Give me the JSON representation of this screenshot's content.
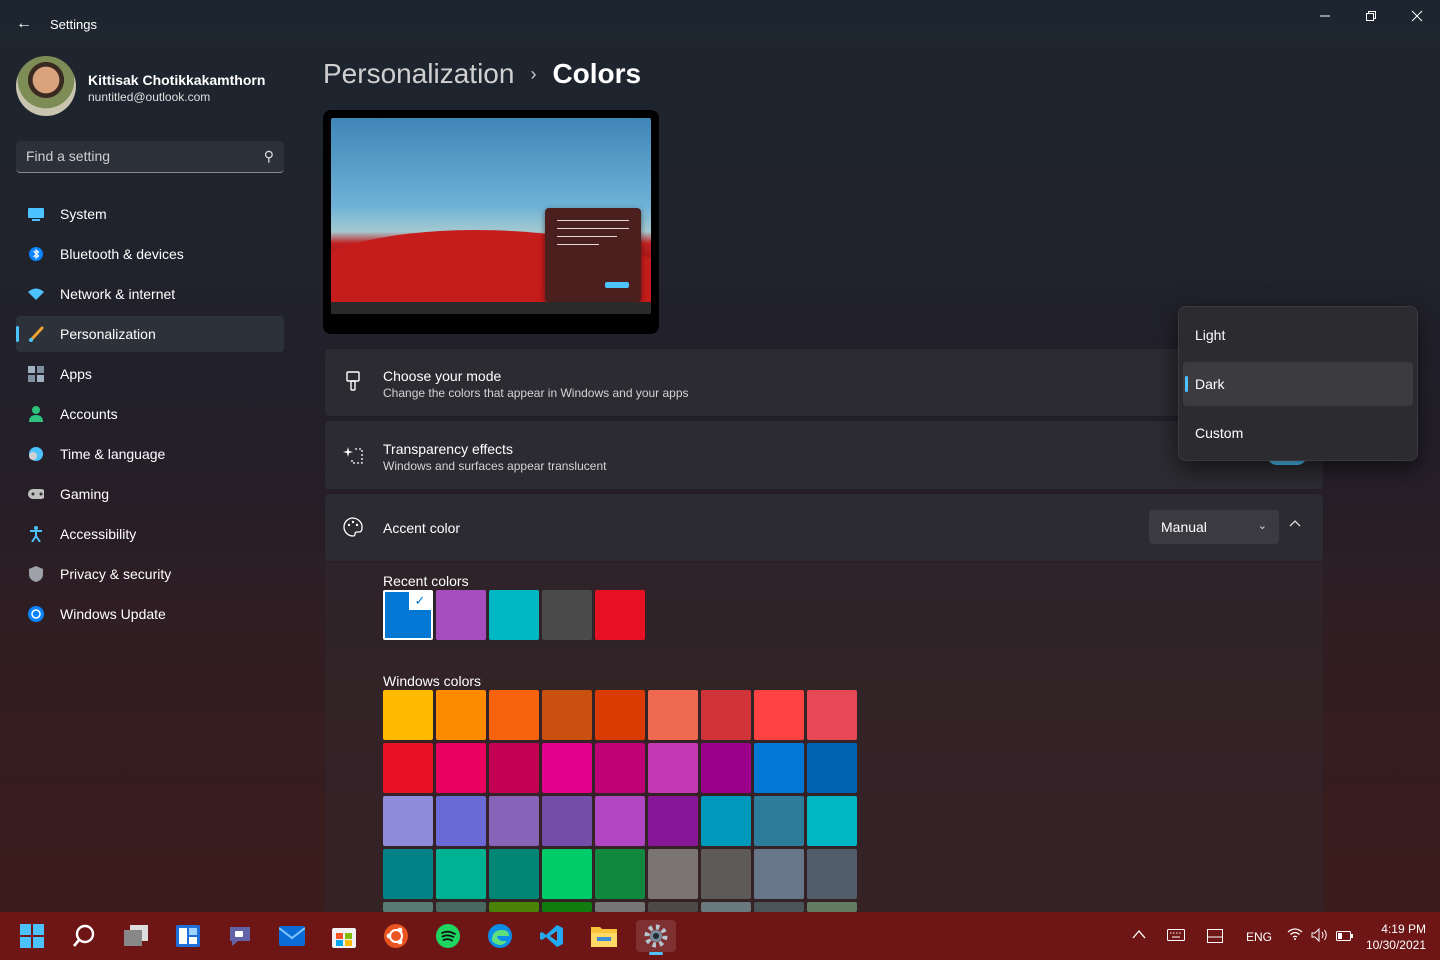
{
  "window": {
    "title": "Settings"
  },
  "profile": {
    "name": "Kittisak Chotikkakamthorn",
    "email": "nuntitled@outlook.com"
  },
  "search": {
    "placeholder": "Find a setting"
  },
  "nav": [
    {
      "label": "System",
      "icon": "monitor-icon",
      "color": "#4cc2ff"
    },
    {
      "label": "Bluetooth & devices",
      "icon": "bluetooth-icon",
      "color": "#0a84ff"
    },
    {
      "label": "Network & internet",
      "icon": "wifi-icon",
      "color": "#4cc2ff"
    },
    {
      "label": "Personalization",
      "icon": "brush-icon",
      "color": "#f0a030",
      "active": true
    },
    {
      "label": "Apps",
      "icon": "apps-icon",
      "color": "#a0b0c0"
    },
    {
      "label": "Accounts",
      "icon": "person-icon",
      "color": "#2ec27e"
    },
    {
      "label": "Time & language",
      "icon": "globe-clock-icon",
      "color": "#4cc2ff"
    },
    {
      "label": "Gaming",
      "icon": "gamepad-icon",
      "color": "#c0c0c0"
    },
    {
      "label": "Accessibility",
      "icon": "accessibility-icon",
      "color": "#4cc2ff"
    },
    {
      "label": "Privacy & security",
      "icon": "shield-icon",
      "color": "#a0a0a8"
    },
    {
      "label": "Windows Update",
      "icon": "update-icon",
      "color": "#4cc2ff"
    }
  ],
  "breadcrumb": {
    "parent": "Personalization",
    "current": "Colors"
  },
  "mode": {
    "title": "Choose your mode",
    "subtitle": "Change the colors that appear in Windows and your apps"
  },
  "transparency": {
    "title": "Transparency effects",
    "subtitle": "Windows and surfaces appear translucent",
    "state_label": "On",
    "on": true
  },
  "accent": {
    "title": "Accent color",
    "selected": "Manual"
  },
  "mode_options": [
    {
      "label": "Light",
      "selected": false
    },
    {
      "label": "Dark",
      "selected": true
    },
    {
      "label": "Custom",
      "selected": false
    }
  ],
  "recent_colors_label": "Recent colors",
  "recent_colors": [
    "#0078d4",
    "#a54dbf",
    "#00b7c3",
    "#4a4a4a",
    "#e81123"
  ],
  "windows_colors_label": "Windows colors",
  "windows_colors": [
    "#ffb900",
    "#ff8c00",
    "#f7630c",
    "#ca5010",
    "#da3b01",
    "#ef6950",
    "#d13438",
    "#ff4343",
    "#e74856",
    "#e81123",
    "#ea005e",
    "#c30052",
    "#e3008c",
    "#bf0077",
    "#c239b3",
    "#9a0089",
    "#0078d4",
    "#0063b1",
    "#8e8cd8",
    "#6b69d6",
    "#8764b8",
    "#744da9",
    "#b146c2",
    "#881798",
    "#0099bc",
    "#2d7d9a",
    "#00b7c3",
    "#038387",
    "#00b294",
    "#018574",
    "#00cc6a",
    "#10893e",
    "#7a7574",
    "#5d5a58",
    "#68768a",
    "#515c6b",
    "#567c73",
    "#486860",
    "#498205",
    "#107c10",
    "#767676",
    "#4c4a48",
    "#69797e",
    "#4a5459",
    "#647c64"
  ],
  "taskbar": {
    "apps": [
      "windows-start-icon",
      "search-icon",
      "task-view-icon",
      "widgets-icon",
      "teams-chat-icon",
      "mail-icon",
      "store-icon",
      "ubuntu-icon",
      "spotify-icon",
      "edge-icon",
      "vscode-icon",
      "file-explorer-icon",
      "settings-icon"
    ],
    "lang": "ENG",
    "time": "4:19 PM",
    "date": "10/30/2021"
  }
}
